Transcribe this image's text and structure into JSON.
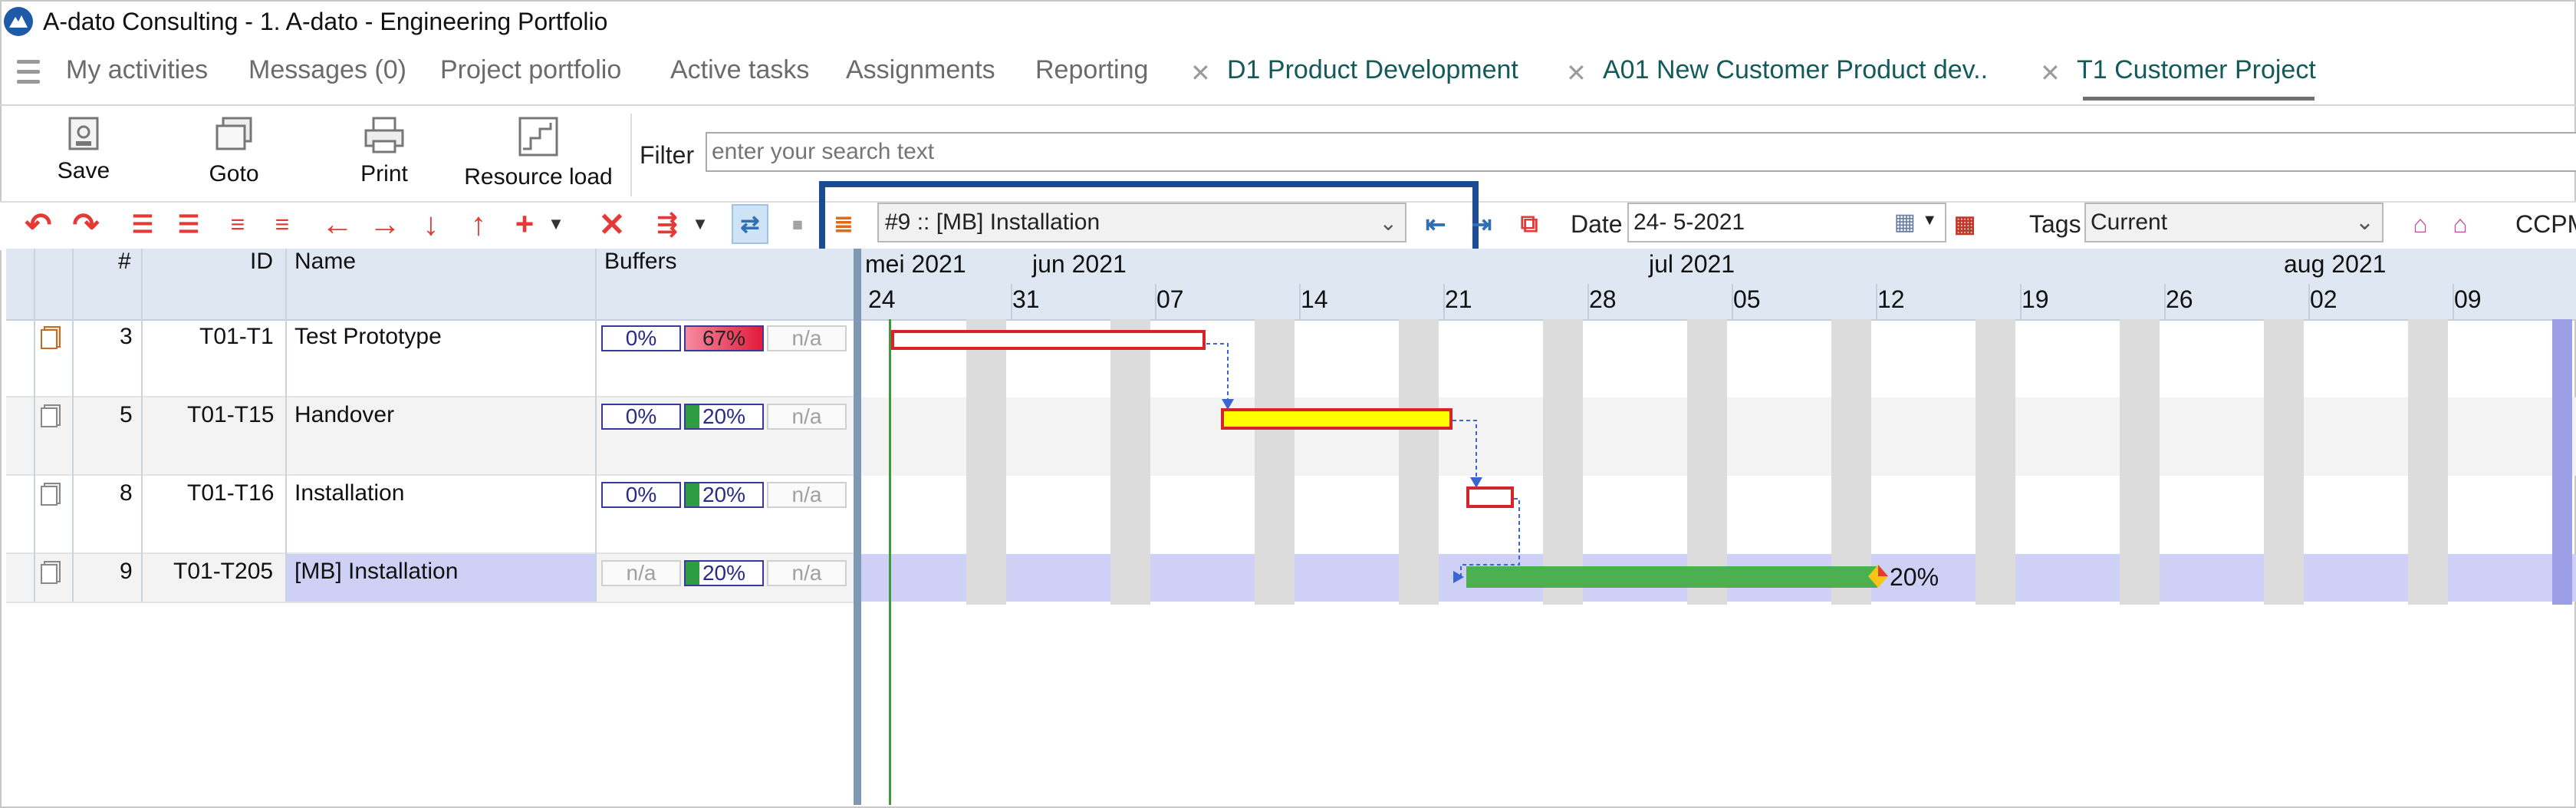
{
  "window": {
    "title": "A-dato Consulting - 1. A-dato - Engineering Portfolio"
  },
  "menu": {
    "items": [
      "My activities",
      "Messages (0)",
      "Project portfolio",
      "Active tasks",
      "Assignments",
      "Reporting"
    ],
    "tabs": [
      "D1 Product Development",
      "A01  New Customer Product dev..",
      "T1 Customer Project"
    ],
    "active_tab": "T1 Customer Project"
  },
  "ribbon": {
    "save": "Save",
    "goto": "Goto",
    "print": "Print",
    "resource_load": "Resource load",
    "filter_label": "Filter",
    "filter_placeholder": "enter your search text"
  },
  "toolbar": {
    "selected_task": "#9 :: [MB]  Installation",
    "date_label": "Date",
    "date_value": "24-  5-2021",
    "tags_label": "Tags",
    "tags_value": "Current",
    "ccpm": "CCPM"
  },
  "grid": {
    "columns": {
      "num": "#",
      "id": "ID",
      "name": "Name",
      "buffers": "Buffers"
    },
    "rows": [
      {
        "num": "3",
        "id": "T01-T1",
        "name": "Test Prototype",
        "buf1": "0%",
        "buf2": "67%",
        "buf3": "n/a"
      },
      {
        "num": "5",
        "id": "T01-T15",
        "name": "Handover",
        "buf1": "0%",
        "buf2": "20%",
        "buf3": "n/a"
      },
      {
        "num": "8",
        "id": "T01-T16",
        "name": "Installation",
        "buf1": "0%",
        "buf2": "20%",
        "buf3": "n/a"
      },
      {
        "num": "9",
        "id": "T01-T205",
        "name": "[MB]  Installation",
        "buf1": "n/a",
        "buf2": "20%",
        "buf3": "n/a"
      }
    ]
  },
  "gantt": {
    "months": [
      "mei 2021",
      "jun 2021",
      "jul 2021",
      "aug 2021"
    ],
    "days": [
      "24",
      "31",
      "07",
      "14",
      "21",
      "28",
      "05",
      "12",
      "19",
      "26",
      "02",
      "09"
    ],
    "buffer_progress_label": "20%",
    "colors": {
      "task_border": "#d8232a",
      "task_critical_fill": "#ffff00",
      "buffer_bar": "#4caf50",
      "selected_row": "#cfd0f5"
    }
  }
}
